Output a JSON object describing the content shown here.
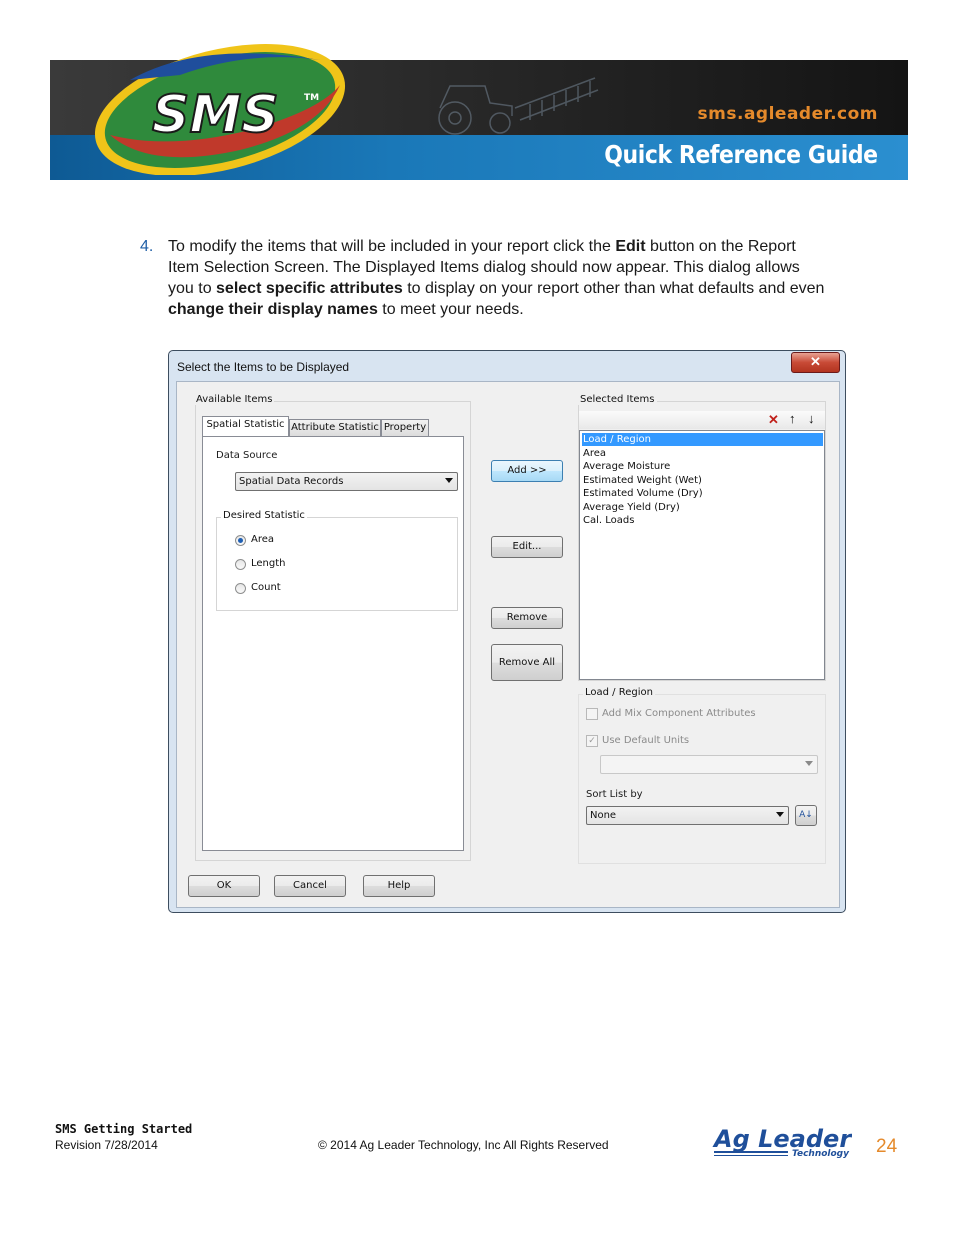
{
  "header": {
    "logo_text": "SMS",
    "url": "sms.agleader.com",
    "guide_title": "Quick Reference Guide"
  },
  "step": {
    "number": "4.",
    "text_parts": [
      {
        "t": "To modify the items that will be included in your report click the ",
        "bold": false
      },
      {
        "t": "Edit",
        "bold": true
      },
      {
        "t": " button on the Report Item Selection Screen. The Displayed Items dialog should now appear. This dialog allows you to ",
        "bold": false
      },
      {
        "t": "select specific attributes",
        "bold": true
      },
      {
        "t": " to display on your report other than what defaults and even ",
        "bold": false
      },
      {
        "t": "change their display names",
        "bold": true
      },
      {
        "t": " to meet your needs.",
        "bold": false
      }
    ]
  },
  "dialog": {
    "title": "Select the Items to be Displayed",
    "close_glyph": "✕",
    "available_items_label": "Available Items",
    "tabs": [
      "Spatial Statistic",
      "Attribute Statistic",
      "Property"
    ],
    "data_source_label": "Data Source",
    "data_source_value": "Spatial Data Records",
    "desired_statistic_label": "Desired Statistic",
    "statistics": [
      {
        "label": "Area",
        "checked": true
      },
      {
        "label": "Length",
        "checked": false
      },
      {
        "label": "Count",
        "checked": false
      }
    ],
    "buttons": {
      "add": "Add >>",
      "edit": "Edit...",
      "remove": "Remove",
      "remove_all": "Remove All",
      "ok": "OK",
      "cancel": "Cancel",
      "help": "Help"
    },
    "selected_items_label": "Selected Items",
    "selected_items": [
      "Load / Region",
      "Area",
      "Average Moisture",
      "Estimated Weight (Wet)",
      "Estimated Volume (Dry)",
      "Average Yield (Dry)",
      "Cal. Loads"
    ],
    "selected_index": 0,
    "group_label": "Load / Region",
    "add_mix_label": "Add Mix Component Attributes",
    "use_default_units_label": "Use Default Units",
    "sort_list_by_label": "Sort List by",
    "sort_value": "None",
    "sort_icon_glyph": "A↓"
  },
  "footer": {
    "doc_title": "SMS Getting Started",
    "revision": "Revision 7/28/2014",
    "copyright": "© 2014 Ag Leader Technology, Inc All Rights Reserved",
    "brand": "Ag Leader",
    "brand_sub": "Technology",
    "page_number": "24"
  }
}
